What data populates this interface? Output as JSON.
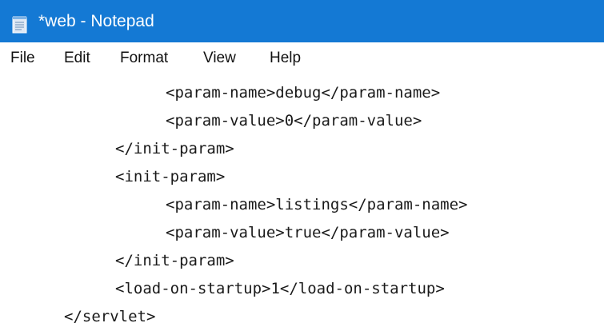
{
  "window": {
    "title": "*web - Notepad",
    "titlebar_color": "#1479d4",
    "icon": "notepad-icon"
  },
  "menu": {
    "items": [
      "File",
      "Edit",
      "Format",
      "View",
      "Help"
    ]
  },
  "editor": {
    "lines": [
      "<param-name>debug</param-name>",
      "<param-value>0</param-value>",
      "</init-param>",
      "<init-param>",
      "<param-name>listings</param-name>",
      "<param-value>true</param-value>",
      "</init-param>",
      "<load-on-startup>1</load-on-startup>",
      "</servlet>"
    ]
  }
}
